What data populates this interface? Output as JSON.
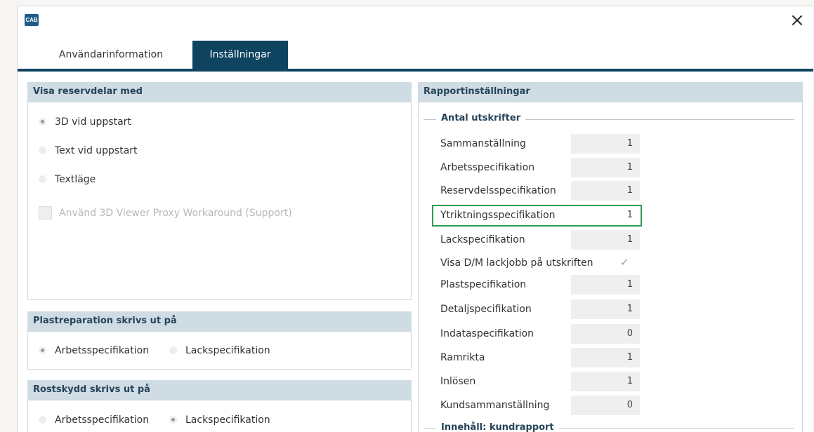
{
  "window": {
    "logo_text": "CAB",
    "close_glyph": "×"
  },
  "tabs": [
    {
      "label": "Användarinformation",
      "active": false
    },
    {
      "label": "Inställningar",
      "active": true
    }
  ],
  "spare_parts": {
    "title": "Visa reservdelar med",
    "options": [
      {
        "label": "3D vid uppstart",
        "checked": true
      },
      {
        "label": "Text vid uppstart",
        "checked": false
      },
      {
        "label": "Textläge",
        "checked": false
      }
    ],
    "proxy_checkbox_label": "Använd 3D Viewer Proxy Workaround (Support)"
  },
  "plastic_repair": {
    "title": "Plastreparation skrivs ut på",
    "options": [
      {
        "label": "Arbetsspecifikation",
        "checked": true
      },
      {
        "label": "Lackspecifikation",
        "checked": false
      }
    ]
  },
  "rust_protection": {
    "title": "Rostskydd skrivs ut på",
    "options": [
      {
        "label": "Arbetsspecifikation",
        "checked": false
      },
      {
        "label": "Lackspecifikation",
        "checked": true
      }
    ]
  },
  "report": {
    "title": "Rapportinställningar",
    "group_title": "Antal utskrifter",
    "group2_title": "Innehåll: kundrapport",
    "rows": [
      {
        "label": "Sammanställning",
        "value": "1"
      },
      {
        "label": "Arbetsspecifikation",
        "value": "1"
      },
      {
        "label": "Reservdelsspecifikation",
        "value": "1"
      },
      {
        "label": "Ytriktningsspecifikation",
        "value": "1",
        "highlighted": true
      },
      {
        "label": "Lackspecifikation",
        "value": "1"
      },
      {
        "label": "Visa D/M lackjobb på utskriften",
        "type": "checkbox",
        "checked": true,
        "check_glyph": "✓"
      },
      {
        "label": "Plastspecifikation",
        "value": "1"
      },
      {
        "label": "Detaljspecifikation",
        "value": "1"
      },
      {
        "label": "Indataspecifikation",
        "value": "0"
      },
      {
        "label": "Ramrikta",
        "value": "1"
      },
      {
        "label": "Inlösen",
        "value": "1"
      },
      {
        "label": "Kundsammanställning",
        "value": "0"
      }
    ]
  },
  "colors": {
    "tab_active_bg": "#0e4460",
    "section_header_bg": "#cfdce3",
    "highlight_border": "#2e9a52"
  }
}
